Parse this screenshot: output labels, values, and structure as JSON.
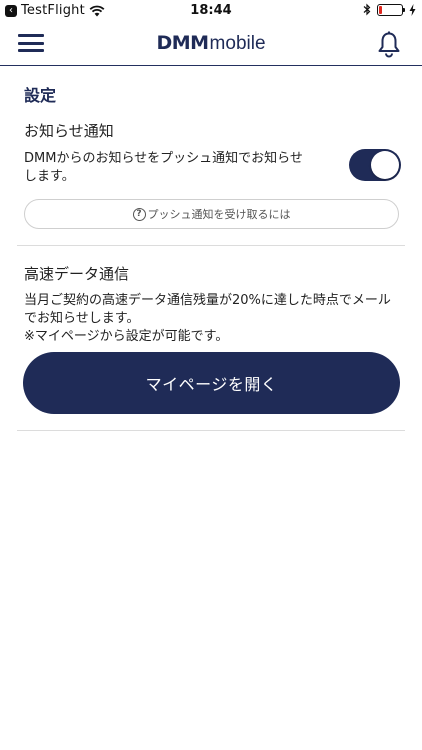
{
  "status_bar": {
    "back_app": "TestFlight",
    "time": "18:44",
    "battery_level_fraction": 0.15,
    "battery_color": "#e0281f"
  },
  "header": {
    "brand_bold": "DMM",
    "brand_light": "mobile",
    "menu_icon": "hamburger-menu-icon",
    "bell_icon": "bell-icon",
    "accent_color": "#1f2b57"
  },
  "page": {
    "title": "設定"
  },
  "notification": {
    "label": "お知らせ通知",
    "description_line1": "DMMからのお知らせをプッシュ通知でお知らせ",
    "description_line2": "します。",
    "toggle_on": true,
    "help_icon": "question-circle-icon",
    "help_text": "プッシュ通知を受け取るには"
  },
  "data_section": {
    "label": "高速データ通信",
    "description_line1": "当月ご契約の高速データ通信残量が20%に達した時点でメール",
    "description_line2": "でお知らせします。",
    "note": "※マイページから設定が可能です。",
    "button_label": "マイページを開く"
  }
}
